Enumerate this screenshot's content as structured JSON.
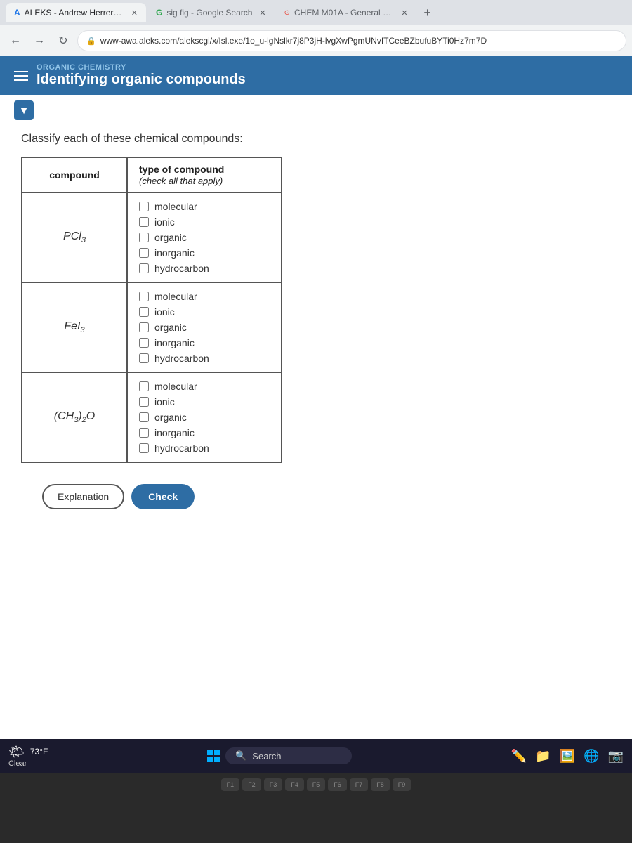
{
  "browser": {
    "tabs": [
      {
        "id": "tab1",
        "icon": "A",
        "label": "ALEKS - Andrew Herrera - Learn",
        "active": true,
        "icon_color": "#1a73e8"
      },
      {
        "id": "tab2",
        "icon": "G",
        "label": "sig fig - Google Search",
        "active": false,
        "icon_color": "#34a853"
      },
      {
        "id": "tab3",
        "icon": "⊙",
        "label": "CHEM M01A - General Chemistry",
        "active": false,
        "icon_color": "#ea4335"
      }
    ],
    "address": "www-awa.aleks.com/alekscgi/x/Isl.exe/1o_u-lgNslkr7j8P3jH-lvgXwPgmUNvITCeeBZbufuBYTi0Hz7m7D",
    "nav": {
      "back": "←",
      "forward": "→",
      "refresh": "↻"
    }
  },
  "aleks": {
    "subtitle": "ORGANIC CHEMISTRY",
    "title": "Identifying organic compounds",
    "question": "Classify each of these chemical compounds:",
    "table": {
      "headers": {
        "compound": "compound",
        "type": "type of compound",
        "type_sub": "(check all that apply)"
      },
      "rows": [
        {
          "compound_html": "PCl₃",
          "compound_label": "PCl3",
          "options": [
            "molecular",
            "ionic",
            "organic",
            "inorganic",
            "hydrocarbon"
          ]
        },
        {
          "compound_html": "FeI₃",
          "compound_label": "FeI3",
          "options": [
            "molecular",
            "ionic",
            "organic",
            "inorganic",
            "hydrocarbon"
          ]
        },
        {
          "compound_html": "(CH₃)₂O",
          "compound_label": "(CH3)2O",
          "options": [
            "molecular",
            "ionic",
            "organic",
            "inorganic",
            "hydrocarbon"
          ]
        }
      ]
    },
    "buttons": {
      "explanation": "Explanation",
      "check": "Check"
    }
  },
  "taskbar": {
    "weather": {
      "temp": "73°F",
      "condition": "Clear"
    },
    "search_placeholder": "Search"
  },
  "keyboard": {
    "keys": [
      "F1",
      "F2",
      "F3",
      "F4",
      "F5",
      "F6",
      "F7",
      "F8",
      "F9"
    ]
  }
}
